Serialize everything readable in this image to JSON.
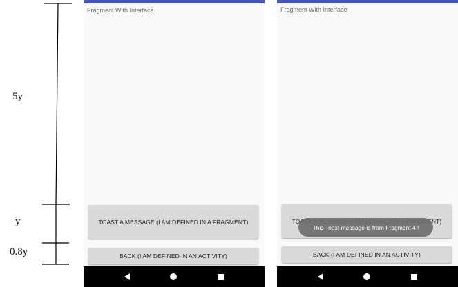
{
  "annotation": {
    "labels": [
      "5y",
      "y",
      "0.8y"
    ]
  },
  "screens": [
    {
      "fragment_title": "Fragment With Interface",
      "toast_button_label": "TOAST A MESSAGE (I AM DEFINED IN A FRAGMENT)",
      "back_button_label": "BACK (I AM DEFINED IN AN ACTIVITY)"
    },
    {
      "fragment_title": "Fragment With Interface",
      "toast_button_label": "TOAST A MESSAGE (I AM DEFINED IN A FRAGMENT)",
      "back_button_label": "BACK (I AM DEFINED IN AN ACTIVITY)",
      "toast_text": "This Toast message is from Fragment 4 !"
    }
  ],
  "navbar": {
    "icons": [
      "back-triangle-icon",
      "home-circle-icon",
      "recents-square-icon"
    ]
  },
  "colors": {
    "status_strip": "#4556b4",
    "button_bg": "#d9d9d9",
    "toast_bg": "#6e6e6e",
    "navbar_bg": "#000000"
  }
}
